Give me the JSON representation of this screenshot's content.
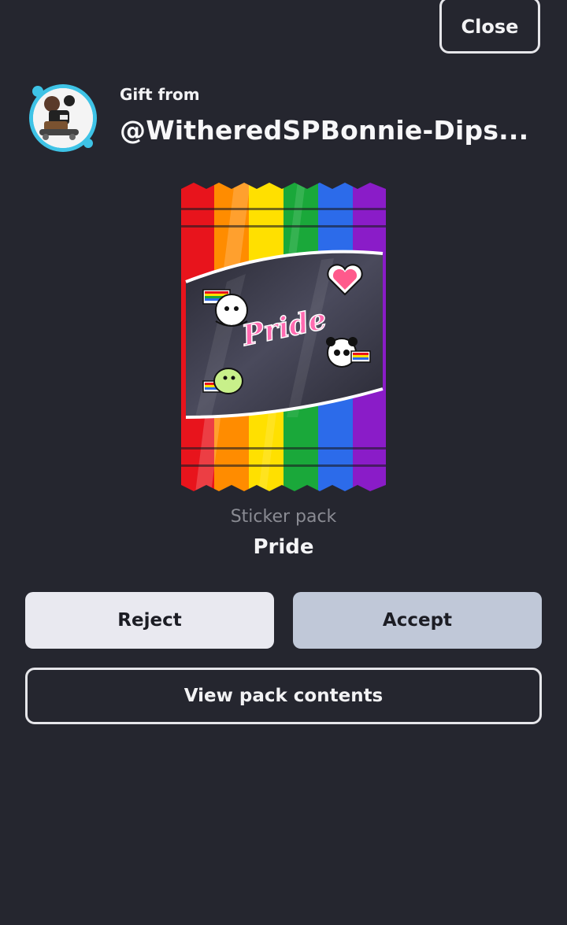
{
  "header": {
    "close_label": "Close"
  },
  "gift": {
    "from_label": "Gift from",
    "sender_name": "@WitheredSPBonnie-Dips...",
    "avatar_icon": "user-avatar"
  },
  "pack": {
    "type_label": "Sticker pack",
    "name": "Pride",
    "image_text": "Pride"
  },
  "actions": {
    "reject_label": "Reject",
    "accept_label": "Accept",
    "view_label": "View pack contents"
  },
  "colors": {
    "background": "#25262f",
    "accept_bg": "#c0c8d8",
    "reject_bg": "#e9e9f0",
    "rainbow": [
      "#e8141c",
      "#ff8c00",
      "#ffe000",
      "#1aa83a",
      "#2c6bea",
      "#8a1cc8"
    ]
  }
}
